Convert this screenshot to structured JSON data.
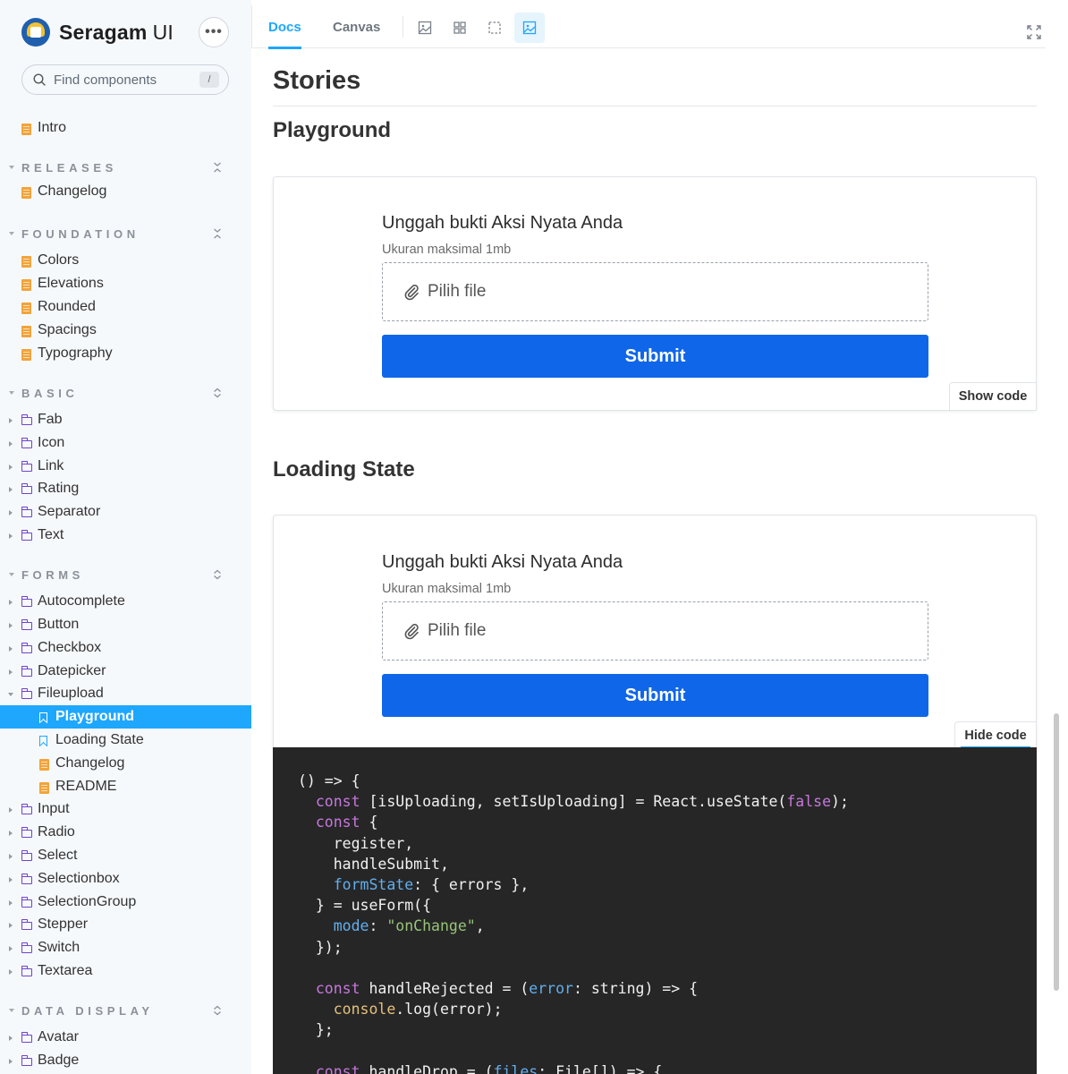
{
  "brand": {
    "name": "Seragam",
    "suffix": "UI",
    "menu": "•••"
  },
  "search": {
    "placeholder": "Find components",
    "shortcut": "/"
  },
  "sidebar": {
    "intro": "Intro",
    "releases": {
      "title": "RELEASES",
      "items": [
        "Changelog"
      ]
    },
    "foundation": {
      "title": "FOUNDATION",
      "items": [
        "Colors",
        "Elevations",
        "Rounded",
        "Spacings",
        "Typography"
      ]
    },
    "basic": {
      "title": "BASIC",
      "items": [
        "Fab",
        "Icon",
        "Link",
        "Rating",
        "Separator",
        "Text"
      ]
    },
    "forms": {
      "title": "FORMS",
      "items_before": [
        "Autocomplete",
        "Button",
        "Checkbox",
        "Datepicker"
      ],
      "expanded": "Fileupload",
      "children": [
        {
          "label": "Playground",
          "type": "story",
          "active": true
        },
        {
          "label": "Loading State",
          "type": "story",
          "active": false
        },
        {
          "label": "Changelog",
          "type": "doc",
          "active": false
        },
        {
          "label": "README",
          "type": "doc",
          "active": false
        }
      ],
      "items_after": [
        "Input",
        "Radio",
        "Select",
        "Selectionbox",
        "SelectionGroup",
        "Stepper",
        "Switch",
        "Textarea"
      ]
    },
    "data_display": {
      "title": "DATA DISPLAY",
      "items": [
        "Avatar",
        "Badge"
      ]
    }
  },
  "toolbar": {
    "tabs": [
      "Docs",
      "Canvas"
    ],
    "active_tab": "Docs"
  },
  "docs": {
    "heading": "Stories",
    "stories": [
      {
        "title": "Playground",
        "form_title": "Unggah bukti Aksi Nyata Anda",
        "form_sub": "Ukuran maksimal 1mb",
        "file_label": "Pilih file",
        "submit": "Submit",
        "code_button": "Show code"
      },
      {
        "title": "Loading State",
        "form_title": "Unggah bukti Aksi Nyata Anda",
        "form_sub": "Ukuran maksimal 1mb",
        "file_label": "Pilih file",
        "submit": "Submit",
        "code_button": "Hide code"
      }
    ],
    "code_lines": [
      "() => {",
      "  const [isUploading, setIsUploading] = React.useState(false);",
      "  const {",
      "    register,",
      "    handleSubmit,",
      "    formState: { errors },",
      "  } = useForm({",
      "    mode: \"onChange\",",
      "  });",
      "",
      "  const handleRejected = (error: string) => {",
      "    console.log(error);",
      "  };",
      "",
      "  const handleDrop = (files: File[]) => {"
    ]
  },
  "colors": {
    "accent": "#1ea7fd",
    "submit": "#1066e8",
    "code_bg": "#262626"
  }
}
